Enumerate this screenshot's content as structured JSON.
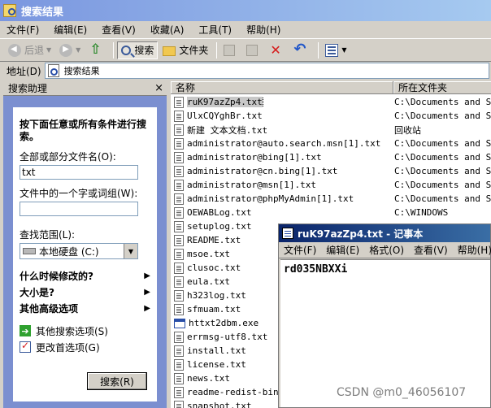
{
  "window": {
    "title": "搜索结果"
  },
  "menubar": [
    "文件(F)",
    "编辑(E)",
    "查看(V)",
    "收藏(A)",
    "工具(T)",
    "帮助(H)"
  ],
  "toolbar": {
    "back": "后退",
    "search": "搜索",
    "folders": "文件夹"
  },
  "address": {
    "label": "地址(D)",
    "value": "搜索结果"
  },
  "search_pane": {
    "title": "搜索助理",
    "close": "×",
    "heading": "按下面任意或所有条件进行搜索。",
    "filename_label": "全部或部分文件名(O):",
    "filename_value": "txt",
    "word_label": "文件中的一个字或词组(W):",
    "word_value": "",
    "lookin_label": "查找范围(L):",
    "lookin_value": "本地硬盘 (C:)",
    "options": [
      "什么时候修改的?",
      "大小是?",
      "其他高级选项"
    ],
    "links": [
      "其他搜索选项(S)",
      "更改首选项(G)"
    ],
    "search_button": "搜索(R)"
  },
  "results": {
    "columns": [
      "名称",
      "所在文件夹"
    ],
    "rows": [
      {
        "name": "ruK97azZp4.txt",
        "folder": "C:\\Documents and Se",
        "selected": true
      },
      {
        "name": "UlxCQYghBr.txt",
        "folder": "C:\\Documents and Se"
      },
      {
        "name": "新建 文本文档.txt",
        "folder": "回收站"
      },
      {
        "name": "administrator@auto.search.msn[1].txt",
        "folder": "C:\\Documents and Se"
      },
      {
        "name": "administrator@bing[1].txt",
        "folder": "C:\\Documents and Se"
      },
      {
        "name": "administrator@cn.bing[1].txt",
        "folder": "C:\\Documents and Se"
      },
      {
        "name": "administrator@msn[1].txt",
        "folder": "C:\\Documents and Se"
      },
      {
        "name": "administrator@phpMyAdmin[1].txt",
        "folder": "C:\\Documents and Se"
      },
      {
        "name": "OEWABLog.txt",
        "folder": "C:\\WINDOWS"
      },
      {
        "name": "setuplog.txt",
        "folder": ""
      },
      {
        "name": "README.txt",
        "folder": ""
      },
      {
        "name": "msoe.txt",
        "folder": ""
      },
      {
        "name": "clusoc.txt",
        "folder": ""
      },
      {
        "name": "eula.txt",
        "folder": ""
      },
      {
        "name": "h323log.txt",
        "folder": ""
      },
      {
        "name": "sfmuam.txt",
        "folder": ""
      },
      {
        "name": "httxt2dbm.exe",
        "folder": "",
        "exe": true
      },
      {
        "name": "errmsg-utf8.txt",
        "folder": ""
      },
      {
        "name": "install.txt",
        "folder": ""
      },
      {
        "name": "license.txt",
        "folder": ""
      },
      {
        "name": "news.txt",
        "folder": ""
      },
      {
        "name": "readme-redist-bins",
        "folder": ""
      },
      {
        "name": "snapshot.txt",
        "folder": ""
      }
    ]
  },
  "notepad": {
    "title": "ruK97azZp4.txt - 记事本",
    "menu": [
      "文件(F)",
      "编辑(E)",
      "格式(O)",
      "查看(V)",
      "帮助(H)"
    ],
    "content": "rd035NBXXi"
  },
  "watermark": "CSDN @m0_46056107"
}
